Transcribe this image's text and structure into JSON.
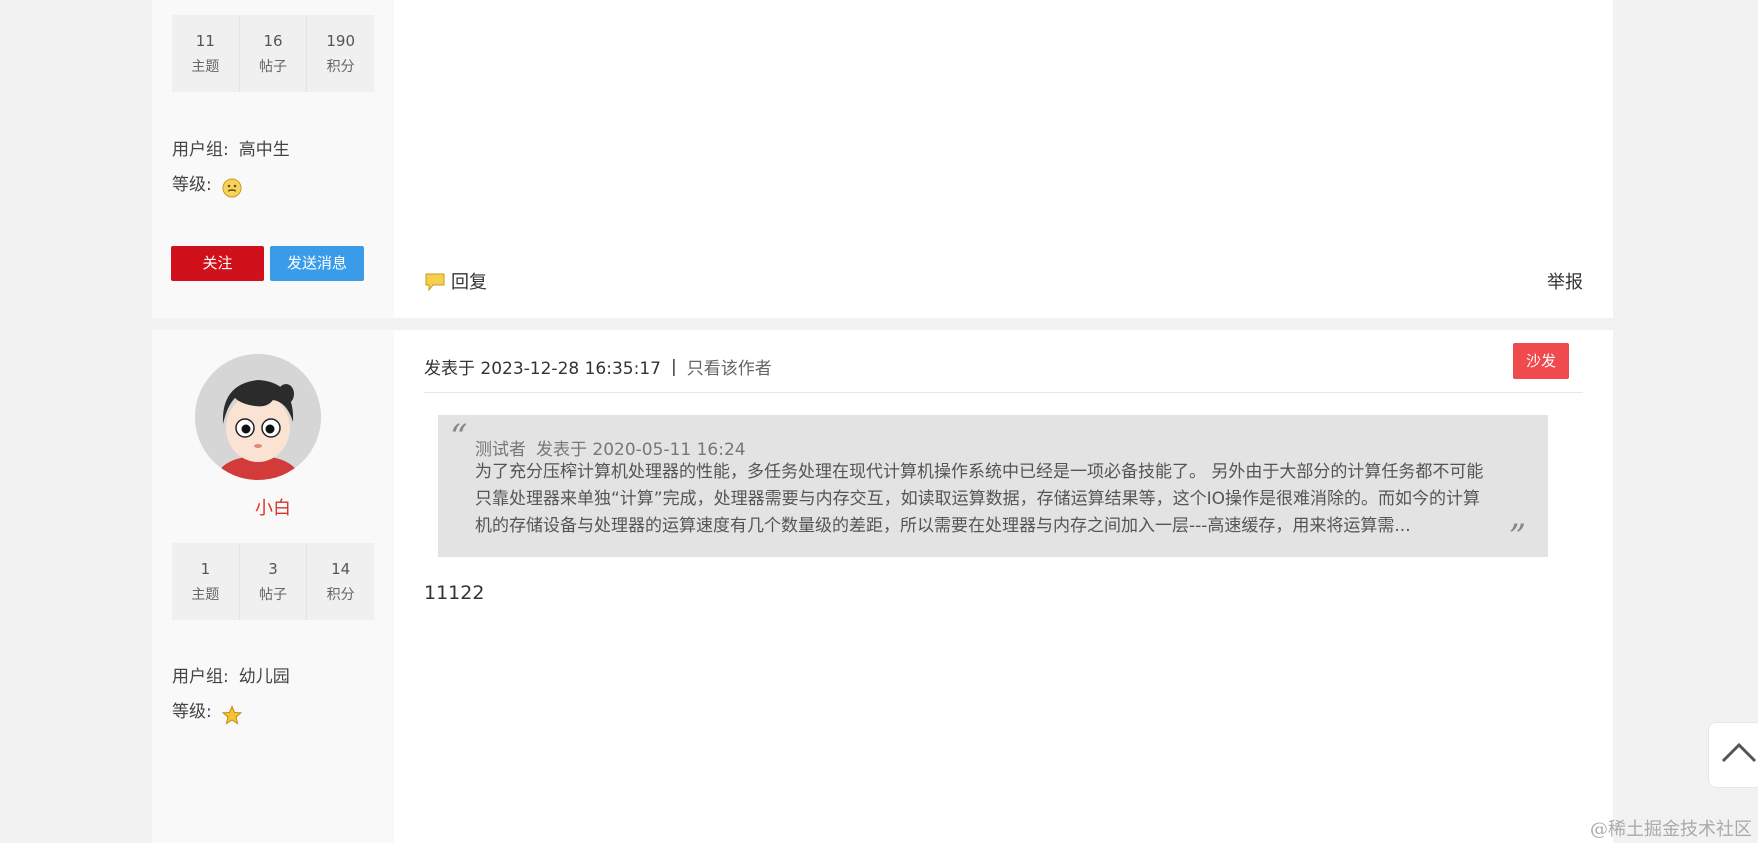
{
  "post1": {
    "stats": [
      {
        "num": "11",
        "label": "主题"
      },
      {
        "num": "16",
        "label": "帖子"
      },
      {
        "num": "190",
        "label": "积分"
      }
    ],
    "group_label": "用户组:",
    "group_value": "高中生",
    "level_label": "等级:",
    "level_icon": "face-icon",
    "follow_label": "关注",
    "message_label": "发送消息",
    "reply_label": "回复",
    "report_label": "举报"
  },
  "post2": {
    "username": "小白",
    "meta_prefix": "发表于 2023-12-28 16:35:17",
    "separator": "|",
    "only_author": "只看该作者",
    "floor_badge": "沙发",
    "quote": {
      "author": "测试者",
      "date": "发表于 2020-05-11 16:24",
      "text": "为了充分压榨计算机处理器的性能，多任务处理在现代计算机操作系统中已经是一项必备技能了。 另外由于大部分的计算任务都不可能只靠处理器来单独“计算”完成，处理器需要与内存交互，如读取运算数据，存储运算结果等，这个IO操作是很难消除的。而如今的计算机的存储设备与处理器的运算速度有几个数量级的差距，所以需要在处理器与内存之间加入一层---高速缓存，用来将运算需..."
    },
    "content": "11122",
    "stats": [
      {
        "num": "1",
        "label": "主题"
      },
      {
        "num": "3",
        "label": "帖子"
      },
      {
        "num": "14",
        "label": "积分"
      }
    ],
    "group_label": "用户组:",
    "group_value": "幼儿园",
    "level_label": "等级:",
    "level_icon": "star-icon"
  },
  "watermark": "@稀土掘金技术社区",
  "colors": {
    "follow": "#d0111b",
    "message": "#3a9ce9",
    "sofa": "#ef4a4d",
    "username": "#d9352c"
  }
}
